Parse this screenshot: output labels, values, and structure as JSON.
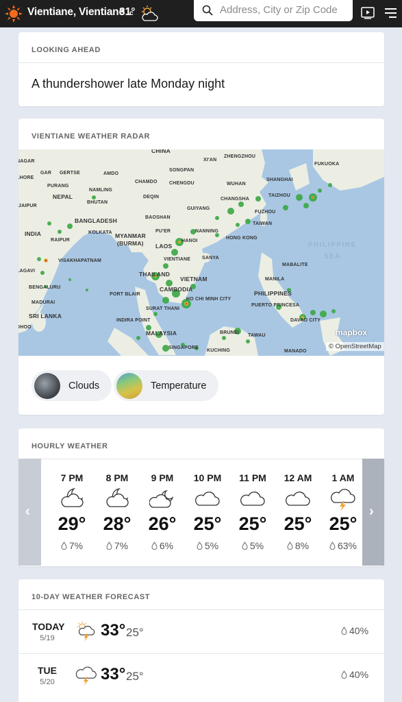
{
  "header": {
    "location": "Vientiane, Vientiane",
    "temp": "31°",
    "unit": "c",
    "search_placeholder": "Address, City or Zip Code",
    "icons": [
      "sun-logo-icon",
      "partly-cloudy-icon",
      "search-icon",
      "video-icon",
      "menu-icon"
    ]
  },
  "looking_ahead": {
    "title": "LOOKING AHEAD",
    "text": "A thundershower late Monday night"
  },
  "radar": {
    "title": "VIENTIANE WEATHER RADAR",
    "attribution_logo": "mapbox",
    "attribution_osm": "© OpenStreetMap",
    "labels": [
      "CHINA",
      "ZHENGZHOU",
      "XI'AN",
      "FUKUOKA",
      "NAGAR",
      "GAR",
      "GERTSE",
      "AMDO",
      "SONGPAN",
      "LHORE",
      "PURANG",
      "CHAMDO",
      "CHENGDU",
      "WUHAN",
      "SHANGHAI",
      "NAMLING",
      "NEPAL",
      "DEQIN",
      "CHANGSHA",
      "TAIZHOU",
      "JAIPUR",
      "BHUTAN",
      "GUIYANG",
      "FUZHOU",
      "BAOSHAN",
      "BANGLADESH",
      "TAIWAN",
      "INDIA",
      "KOLKATA",
      "MYANMAR",
      "(BURMA)",
      "PU'ER",
      "NANNING",
      "HANOI",
      "HONG KONG",
      "RAIPUR",
      "LAOS",
      "VIENTIANE",
      "SANYA",
      "VISAKHAPATNAM",
      "THAILAND",
      "MABALITE",
      "LAGAVI",
      "VIETNAM",
      "MANILA",
      "BENGALURU",
      "CAMBODIA",
      "PORT BLAIR",
      "HO CHI MINH CITY",
      "PHILIPPINES",
      "MADURAI",
      "SURAT THANI",
      "PUERTO PRINCESA",
      "SRI LANKA",
      "INDIRA POINT",
      "DAVAO CITY",
      "DHOO",
      "MALAYSIA",
      "BRUNEI",
      "TAWAU",
      "SINGAPORE",
      "KUCHING",
      "MANADO"
    ],
    "sea_label_1": "PHILIPPINE",
    "sea_label_2": "SEA",
    "layers": [
      {
        "label": "Clouds",
        "icon": "clouds-layer-thumbnail"
      },
      {
        "label": "Temperature",
        "icon": "temperature-layer-thumbnail"
      }
    ]
  },
  "hourly": {
    "title": "HOURLY WEATHER",
    "hours": [
      {
        "time": "7 PM",
        "temp": "29°",
        "precip": "7%",
        "icon": "moon-cloudy-icon"
      },
      {
        "time": "8 PM",
        "temp": "28°",
        "precip": "7%",
        "icon": "moon-cloudy-icon"
      },
      {
        "time": "9 PM",
        "temp": "26°",
        "precip": "6%",
        "icon": "moon-partly-cloudy-icon"
      },
      {
        "time": "10 PM",
        "temp": "25°",
        "precip": "5%",
        "icon": "cloud-icon"
      },
      {
        "time": "11 PM",
        "temp": "25°",
        "precip": "5%",
        "icon": "cloud-icon"
      },
      {
        "time": "12 AM",
        "temp": "25°",
        "precip": "8%",
        "icon": "cloud-icon"
      },
      {
        "time": "1 AM",
        "temp": "25°",
        "precip": "63%",
        "icon": "thunder-cloud-icon"
      }
    ]
  },
  "forecast": {
    "title": "10-DAY WEATHER FORECAST",
    "days": [
      {
        "day": "TODAY",
        "date": "5/19",
        "hi": "33°",
        "lo": "25°",
        "precip": "40%",
        "icon": "sun-thunder-icon"
      },
      {
        "day": "TUE",
        "date": "5/20",
        "hi": "33°",
        "lo": "25°",
        "precip": "40%",
        "icon": "thunder-cloud-icon"
      }
    ]
  },
  "colors": {
    "topbar": "#1f1f1f",
    "page_bg": "#e4e8f0",
    "accent_sun": "#f26b1d",
    "map_water": "#a9c7e3",
    "map_land": "#eceee4"
  }
}
